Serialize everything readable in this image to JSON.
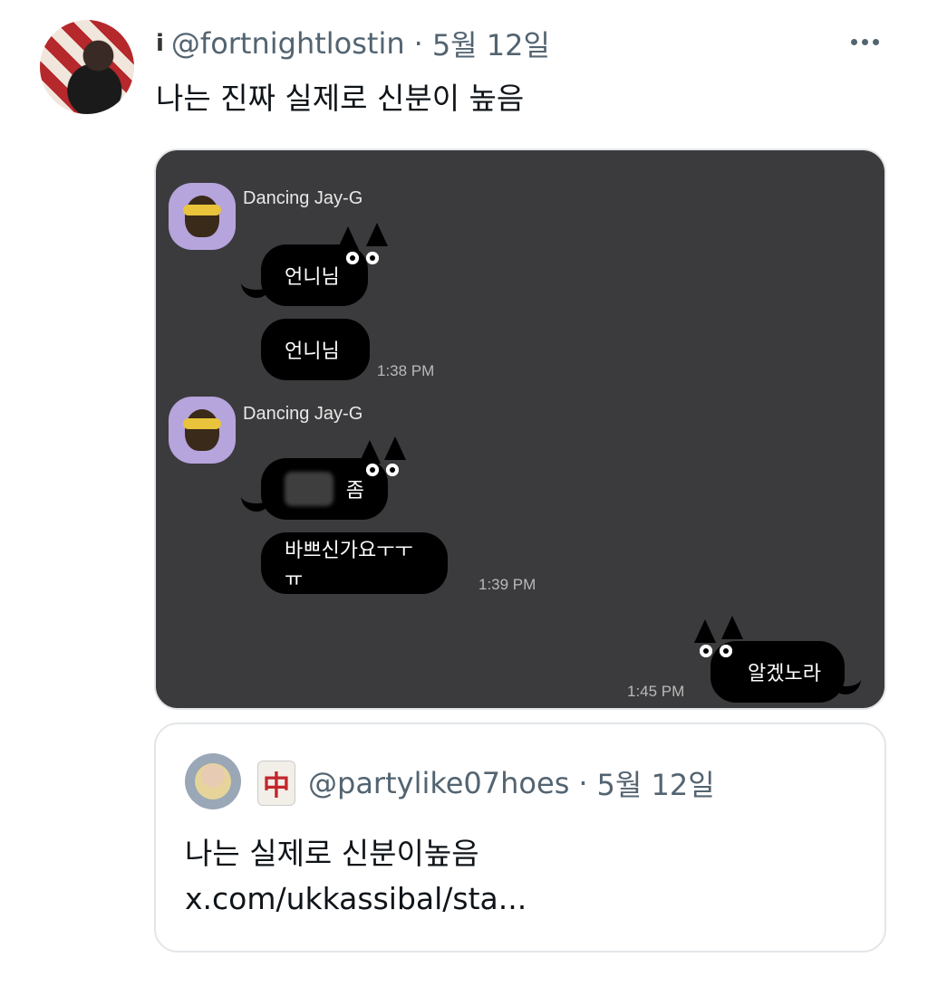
{
  "tweet": {
    "handle_prefix": "i",
    "handle": "@fortnightlostin",
    "separator": "·",
    "date": "5월 12일",
    "text": "나는 진짜 실제로 신분이 높음"
  },
  "chat": {
    "groups": [
      {
        "sender": "Dancing Jay-G",
        "messages": [
          "언니님",
          "언니님"
        ],
        "time": "1:38 PM"
      },
      {
        "sender": "Dancing Jay-G",
        "messages": [
          "좀",
          "바쁘신가요ㅜㅜㅠ"
        ],
        "time": "1:39 PM"
      }
    ],
    "reply": {
      "message": "알겠노라",
      "time": "1:45 PM"
    }
  },
  "quote": {
    "handle": "@partylike07hoes",
    "separator": "·",
    "date": "5월 12일",
    "mahjong_char": "中",
    "text_line1": "나는 실제로 신분이높음",
    "text_line2": "x.com/ukkassibal/sta..."
  },
  "colors": {
    "chat_bg": "#3b3b3d",
    "bubble": "#000000",
    "kakao_avatar": "#b6a4dc",
    "secondary_text": "#536471"
  }
}
